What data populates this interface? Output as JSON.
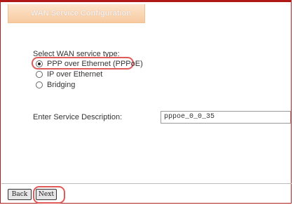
{
  "header": {
    "title": "WAN Service Configuration"
  },
  "form": {
    "service_type_label": "Select WAN service type:",
    "options": [
      {
        "label": "PPP over Ethernet (PPPoE)",
        "selected": true
      },
      {
        "label": "IP over Ethernet",
        "selected": false
      },
      {
        "label": "Bridging",
        "selected": false
      }
    ],
    "description_label": "Enter Service Description:",
    "description_value": "pppoe_0_0_35"
  },
  "footer": {
    "back_label": "Back",
    "next_label": "Next"
  },
  "colors": {
    "accent_border": "#b01818",
    "tab_gradient_top": "#fde5cc",
    "tab_gradient_bottom": "#f7caa0",
    "highlight": "#e05a5a"
  }
}
